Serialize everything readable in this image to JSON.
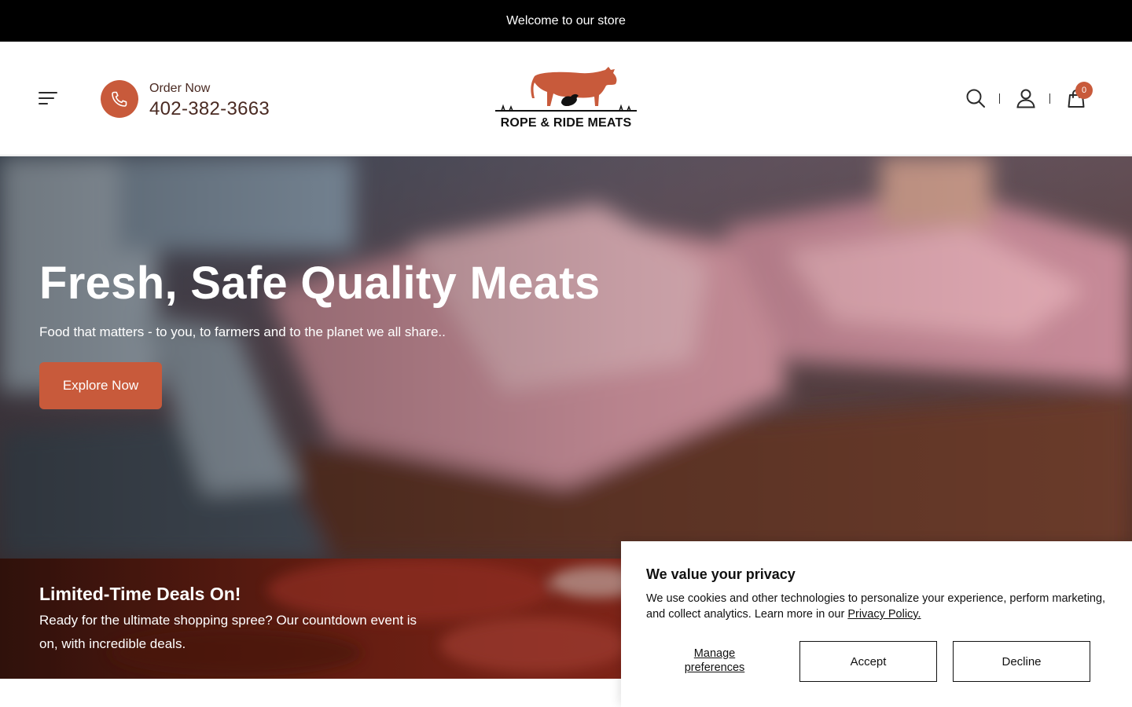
{
  "announcement": "Welcome to our store",
  "header": {
    "order_label": "Order Now",
    "phone": "402-382-3663",
    "logo_text": "ROPE & RIDE MEATS",
    "cart_count": "0"
  },
  "hero": {
    "title": "Fresh, Safe Quality Meats",
    "subtitle": "Food that matters - to you, to farmers and to the planet we all share..",
    "button": "Explore Now"
  },
  "deals": {
    "title": "Limited-Time Deals On!",
    "text": "Ready for the ultimate shopping spree? Our countdown event is on, with incredible deals."
  },
  "cookie": {
    "title": "We value your privacy",
    "text": "We use cookies and other technologies to personalize your experience, perform marketing, and collect analytics. Learn more in our ",
    "link": "Privacy Policy.",
    "manage": "Manage preferences",
    "accept": "Accept",
    "decline": "Decline"
  },
  "colors": {
    "accent": "#c85a3b",
    "announce_bg": "#000000",
    "text_dark": "#4a2a22"
  },
  "icons": [
    "menu-icon",
    "phone-icon",
    "search-icon",
    "account-icon",
    "cart-icon"
  ]
}
